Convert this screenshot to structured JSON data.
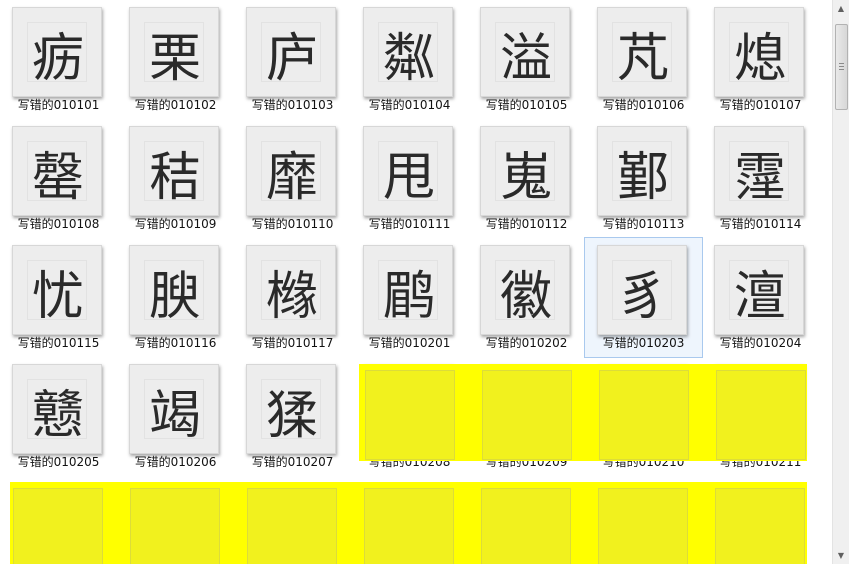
{
  "files": [
    {
      "label": "写错的010101",
      "glyph": "疬"
    },
    {
      "label": "写错的010102",
      "glyph": "栗"
    },
    {
      "label": "写错的010103",
      "glyph": "庐"
    },
    {
      "label": "写错的010104",
      "glyph": "粼"
    },
    {
      "label": "写错的010105",
      "glyph": "溢"
    },
    {
      "label": "写错的010106",
      "glyph": "芃"
    },
    {
      "label": "写错的010107",
      "glyph": "熄"
    },
    {
      "label": "写错的010108",
      "glyph": "罄"
    },
    {
      "label": "写错的010109",
      "glyph": "秸"
    },
    {
      "label": "写错的010110",
      "glyph": "靡"
    },
    {
      "label": "写错的010111",
      "glyph": "甩"
    },
    {
      "label": "写错的010112",
      "glyph": "嵬"
    },
    {
      "label": "写错的010113",
      "glyph": "鄞"
    },
    {
      "label": "写错的010114",
      "glyph": "霪"
    },
    {
      "label": "写错的010115",
      "glyph": "忧"
    },
    {
      "label": "写错的010116",
      "glyph": "腴"
    },
    {
      "label": "写错的010117",
      "glyph": "橼"
    },
    {
      "label": "写错的010201",
      "glyph": "鹛"
    },
    {
      "label": "写错的010202",
      "glyph": "徽"
    },
    {
      "label": "写错的010203",
      "glyph": "豸"
    },
    {
      "label": "写错的010204",
      "glyph": "澶"
    },
    {
      "label": "写错的010205",
      "glyph": "戆"
    },
    {
      "label": "写错的010206",
      "glyph": "竭"
    },
    {
      "label": "写错的010207",
      "glyph": "猱"
    },
    {
      "label": "写错的010208",
      "glyph": ""
    },
    {
      "label": "写错的010209",
      "glyph": ""
    },
    {
      "label": "写错的010210",
      "glyph": ""
    },
    {
      "label": "写错的010211",
      "glyph": ""
    }
  ],
  "selected_index": 19,
  "highlight_color": "#ffff00",
  "scrollbar": {
    "up_icon": "▲",
    "down_icon": "▼"
  }
}
